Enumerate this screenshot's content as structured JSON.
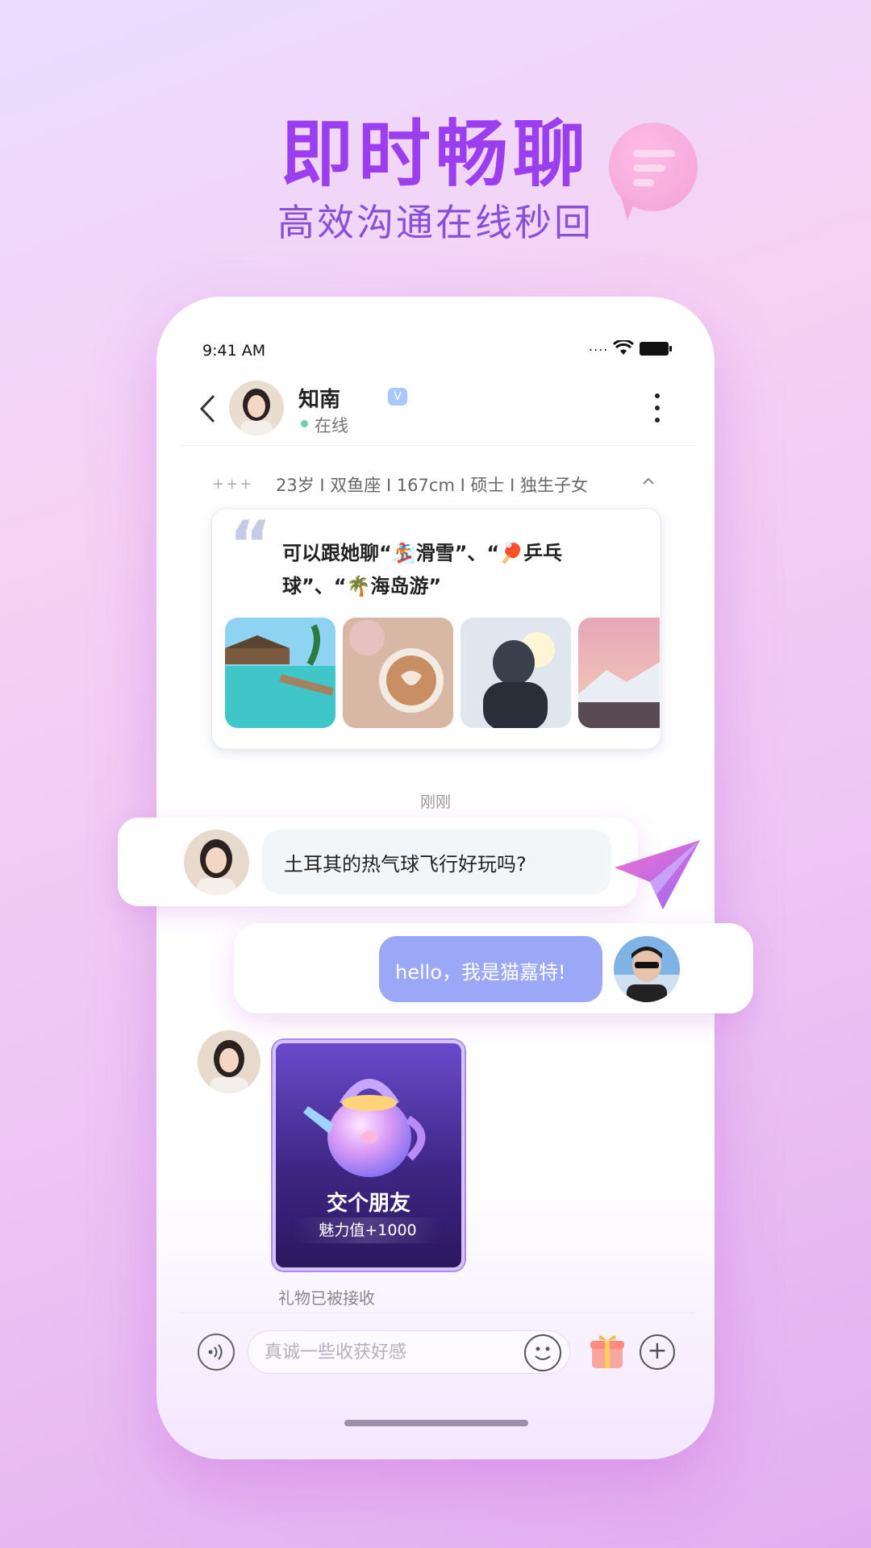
{
  "hero": {
    "title": "即时畅聊",
    "subtitle": "高效沟通在线秒回"
  },
  "status_bar": {
    "time": "9:41 AM",
    "signal": "...."
  },
  "chat_header": {
    "name": "知南",
    "verified_badge": "V",
    "status": "在线"
  },
  "profile": {
    "more_icon_text": "+++",
    "info": "23岁 I 双鱼座 I 167cm I 硕士 I 独生子女",
    "topics_text": "可以跟她聊“🏂滑雪”、“🏓乒乓球”、“🌴海岛游”",
    "photos": [
      "island-beach",
      "latte-art",
      "ski-girl",
      "snow-mountain"
    ]
  },
  "messages": {
    "time_separator": "刚刚",
    "incoming_text": "土耳其的热气球飞行好玩吗?",
    "outgoing_text": "hello，我是猫嘉特!",
    "gift": {
      "title": "交个朋友",
      "charm": "魅力值+1000",
      "status": "礼物已被接收"
    }
  },
  "input_bar": {
    "placeholder": "真诚一些收获好感"
  },
  "colors": {
    "accent": "#9b3ef0",
    "outgoing_bubble": "#9ba8f8",
    "online": "#63d3b4"
  }
}
